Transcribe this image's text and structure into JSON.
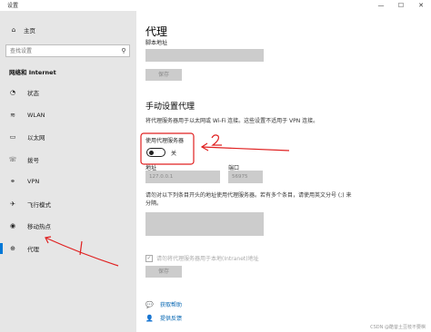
{
  "window": {
    "title": "设置",
    "controls": [
      "—",
      "☐",
      "✕"
    ]
  },
  "sidebar": {
    "home": {
      "label": "主页",
      "icon": "home-icon"
    },
    "search": {
      "placeholder": "查找设置",
      "icon": "search-icon"
    },
    "section_title": "网络和 Internet",
    "items": [
      {
        "label": "状态",
        "icon": "status-icon"
      },
      {
        "label": "WLAN",
        "icon": "wifi-icon"
      },
      {
        "label": "以太网",
        "icon": "ethernet-icon"
      },
      {
        "label": "拨号",
        "icon": "dialup-icon"
      },
      {
        "label": "VPN",
        "icon": "vpn-icon"
      },
      {
        "label": "飞行模式",
        "icon": "airplane-icon"
      },
      {
        "label": "移动热点",
        "icon": "hotspot-icon"
      },
      {
        "label": "代理",
        "icon": "globe-icon",
        "active": true
      }
    ]
  },
  "main": {
    "title": "代理",
    "script_label": "脚本地址",
    "save_label_1": "保存",
    "manual_heading": "手动设置代理",
    "manual_desc": "将代理服务器用于以太网或 Wi-Fi 连接。这些设置不适用于 VPN 连接。",
    "use_proxy_label": "使用代理服务器",
    "toggle_state": "关",
    "address_label": "地址",
    "address_value": "127.0.0.1",
    "port_label": "端口",
    "port_value": "56975",
    "exclude_desc": "请勿对以下列条目开头的地址使用代理服务器。若有多个条目，请使用英文分号 (;) 来分隔。",
    "local_checkbox_label": "请勿将代理服务器用于本地(Intranet)地址",
    "save_label_2": "保存",
    "help_link": "获取帮助",
    "feedback_link": "提供反馈",
    "watermark": "CSDN @酷昔土豆枝不要棋"
  },
  "annotations": {
    "color": "#e02020",
    "label_1": "1",
    "label_2": "2"
  }
}
